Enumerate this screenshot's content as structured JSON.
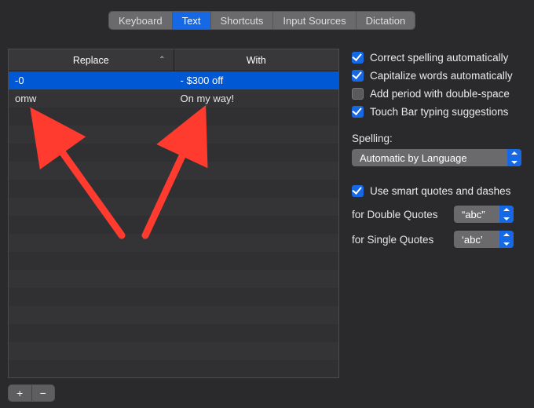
{
  "tabs": [
    "Keyboard",
    "Text",
    "Shortcuts",
    "Input Sources",
    "Dictation"
  ],
  "activeTab": 1,
  "columns": {
    "replace": "Replace",
    "with": "With"
  },
  "rows": [
    {
      "replace": "-0",
      "with": "- $300 off",
      "selected": true
    },
    {
      "replace": "omw",
      "with": "On my way!",
      "selected": false
    }
  ],
  "checks": {
    "spell": {
      "label": "Correct spelling automatically",
      "on": true
    },
    "cap": {
      "label": "Capitalize words automatically",
      "on": true
    },
    "period": {
      "label": "Add period with double-space",
      "on": false
    },
    "touchbar": {
      "label": "Touch Bar typing suggestions",
      "on": true
    },
    "smart": {
      "label": "Use smart quotes and dashes",
      "on": true
    }
  },
  "spellingLabel": "Spelling:",
  "spellingValue": "Automatic by Language",
  "doubleQuotes": {
    "label": "for Double Quotes",
    "value": "“abc”"
  },
  "singleQuotes": {
    "label": "for Single Quotes",
    "value": "‘abc’"
  },
  "buttons": {
    "add": "+",
    "remove": "−"
  }
}
